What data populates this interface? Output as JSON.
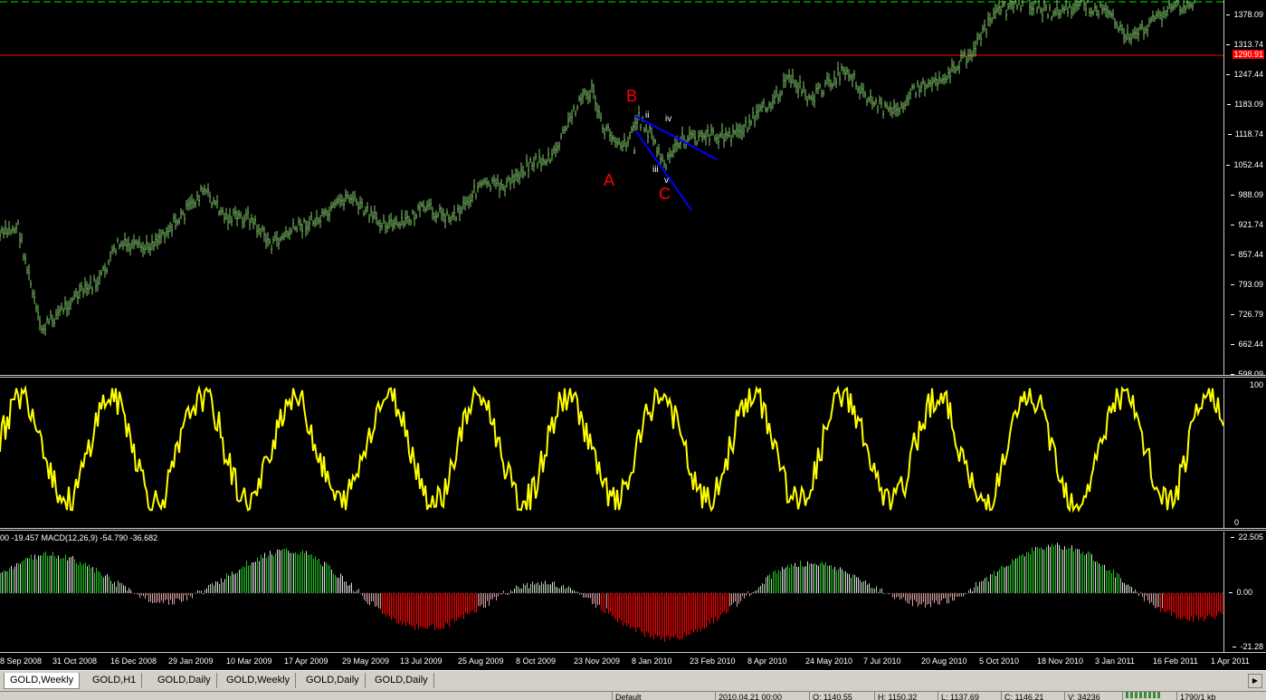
{
  "price_axis": {
    "ticks": [
      "1378.09",
      "1313.74",
      "1247.44",
      "1183.09",
      "1118.74",
      "1052.44",
      "988.09",
      "921.74",
      "857.44",
      "793.09",
      "726.79",
      "662.44",
      "598.09"
    ],
    "current_price": "1290.91",
    "current_price_color": "#ff0000"
  },
  "stoch_axis": {
    "ticks": [
      "100",
      "0"
    ]
  },
  "macd": {
    "info": "00 -19.457  MACD(12,26,9) -54.790 -36.682",
    "ticks": [
      "22.505",
      "0.00",
      "-21.28"
    ]
  },
  "dates": [
    "8 Sep 2008",
    "31 Oct 2008",
    "16 Dec 2008",
    "29 Jan 2009",
    "10 Mar 2009",
    "17 Apr 2009",
    "29 May 2009",
    "13 Jul 2009",
    "25 Aug 2009",
    "8 Oct 2009",
    "23 Nov 2009",
    "8 Jan 2010",
    "23 Feb 2010",
    "8 Apr 2010",
    "24 May 2010",
    "7 Jul 2010",
    "20 Aug 2010",
    "5 Oct 2010",
    "18 Nov 2010",
    "3 Jan 2011",
    "16 Feb 2011",
    "1 Apr 2011"
  ],
  "wave_labels": {
    "A": "A",
    "B": "B",
    "C": "C",
    "i": "i",
    "ii": "ii",
    "iii": "iii",
    "iv": "iv",
    "v": "v",
    "major_color": "#ff0000",
    "minor_color": "#ffffff",
    "trendline_color": "#0000ff"
  },
  "colors": {
    "price": "#7fc86a",
    "stoch": "#ffff00",
    "macd_pos": "#22c022",
    "macd_neg": "#ff0000",
    "hline": "#ff0000",
    "dashed": "#00e000"
  },
  "tabs": [
    "GOLD,Weekly",
    "GOLD,H1",
    "GOLD,Daily",
    "GOLD,Weekly",
    "GOLD,Daily",
    "GOLD,Daily"
  ],
  "active_tab": 0,
  "status": [
    "Default",
    "2010.04.21 00:00",
    "O: 1140.55",
    "H: 1150.32",
    "L: 1137.69",
    "C: 1146.21",
    "V: 34236",
    "1790/1 kb"
  ]
}
